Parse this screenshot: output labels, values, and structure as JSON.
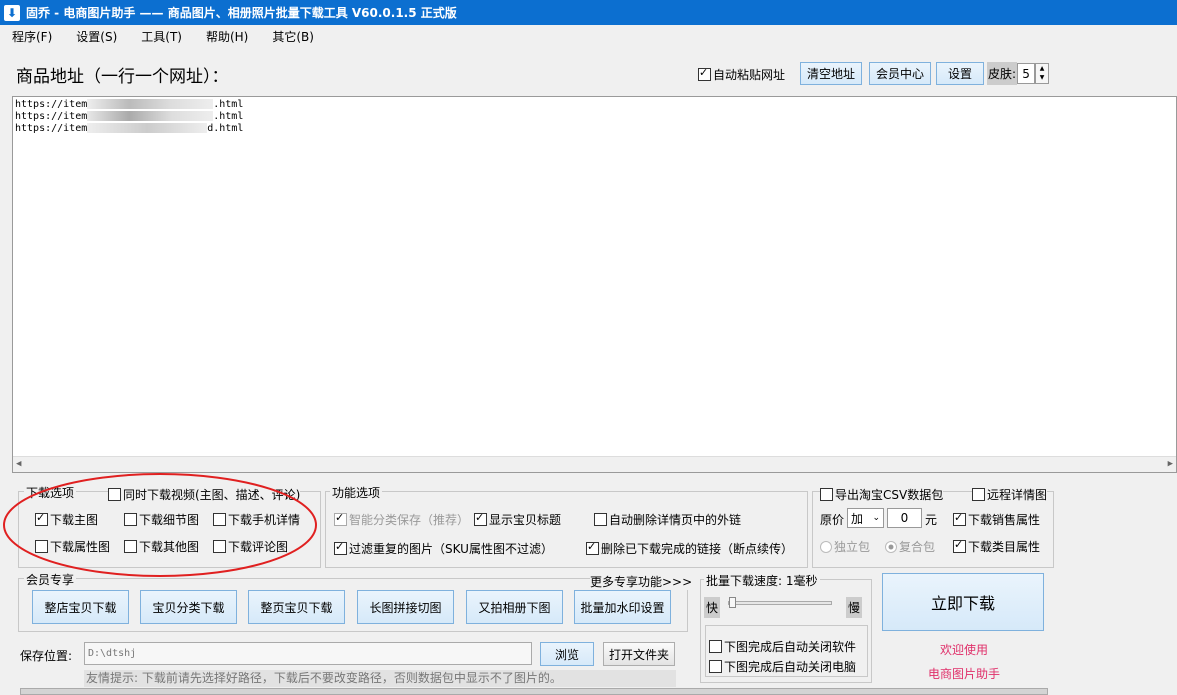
{
  "window": {
    "title": "固乔 - 电商图片助手 —— 商品图片、相册照片批量下载工具 V60.0.1.5 正式版"
  },
  "menu": [
    "程序(F)",
    "设置(S)",
    "工具(T)",
    "帮助(H)",
    "其它(B)"
  ],
  "header": {
    "label": "商品地址（一行一个网址）：",
    "auto_paste": "自动粘贴网址",
    "clear": "清空地址",
    "member_center": "会员中心",
    "settings": "设置",
    "skin_label": "皮肤:",
    "skin_value": "5"
  },
  "urls": [
    "https://item",
    "https://item",
    "https://item"
  ],
  "url_tails": [
    ".html",
    ".html",
    "d.html"
  ],
  "download_options": {
    "legend": "下载选项",
    "video": "同时下载视频(主图、描述、评论)",
    "items": [
      {
        "label": "下载主图",
        "checked": true
      },
      {
        "label": "下载细节图",
        "checked": false
      },
      {
        "label": "下载手机详情",
        "checked": false
      },
      {
        "label": "下载属性图",
        "checked": false
      },
      {
        "label": "下载其他图",
        "checked": false
      },
      {
        "label": "下载评论图",
        "checked": false
      }
    ]
  },
  "function_options": {
    "legend": "功能选项",
    "smart": "智能分类保存（推荐）",
    "show_title": "显示宝贝标题",
    "auto_delete_links": "自动删除详情页中的外链",
    "filter_dup": "过滤重复的图片（SKU属性图不过滤）",
    "delete_done": "删除已下载完成的链接（断点续传）"
  },
  "csv": {
    "export": "导出淘宝CSV数据包",
    "remote": "远程详情图",
    "price_label": "原价",
    "op": "加",
    "value": "0",
    "unit": "元",
    "sales": "下载销售属性",
    "single": "独立包",
    "combined": "复合包",
    "category": "下载类目属性"
  },
  "member": {
    "legend": "会员专享",
    "more": "更多专享功能>>>",
    "buttons": [
      "整店宝贝下载",
      "宝贝分类下载",
      "整页宝贝下载",
      "长图拼接切图",
      "又拍相册下图",
      "批量加水印设置"
    ]
  },
  "speed": {
    "legend": "批量下载速度: 1毫秒",
    "fast": "快",
    "slow": "慢",
    "close_app": "下图完成后自动关闭软件",
    "close_pc": "下图完成后自动关闭电脑"
  },
  "download_now": "立即下载",
  "welcome": "欢迎使用",
  "app_name": "电商图片助手",
  "save": {
    "label": "保存位置:",
    "path": "D:\\dtshj",
    "browse": "浏览",
    "open": "打开文件夹"
  },
  "tip": "友情提示: 下载前请先选择好路径，下载后不要改变路径，否则数据包中显示不了图片的。",
  "colors": {
    "title_bar": "#0c6fd0",
    "highlight_circle": "#e02020",
    "welcome_text": "#e0306a"
  }
}
